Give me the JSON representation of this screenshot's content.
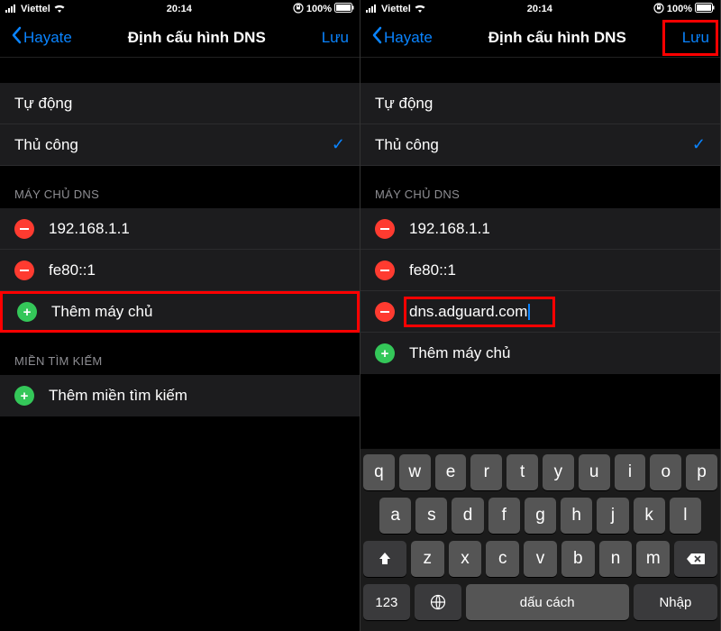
{
  "status": {
    "carrier": "Viettel",
    "time": "20:14",
    "battery": "100%"
  },
  "nav": {
    "back": "Hayate",
    "title": "Định cấu hình DNS",
    "save": "Lưu"
  },
  "mode": {
    "auto": "Tự động",
    "manual": "Thủ công"
  },
  "sections": {
    "dns": "MÁY CHỦ DNS",
    "search": "MIỀN TÌM KIẾM"
  },
  "servers": {
    "a": "192.168.1.1",
    "b": "fe80::1",
    "c": "dns.adguard.com"
  },
  "actions": {
    "add_server": "Thêm máy chủ",
    "add_search": "Thêm miền tìm kiếm"
  },
  "kbd": {
    "mode": "123",
    "space": "dấu cách",
    "return": "Nhập"
  }
}
